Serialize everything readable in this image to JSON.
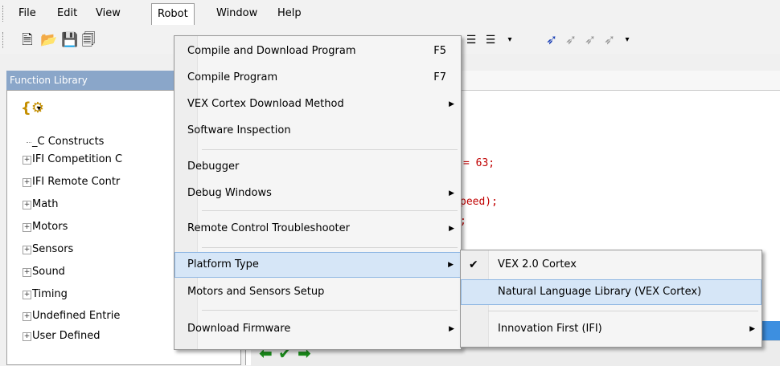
{
  "menubar": {
    "items": [
      "File",
      "Edit",
      "View",
      "Robot",
      "Window",
      "Help"
    ]
  },
  "toolbar": {
    "icons": [
      "new-file-icon",
      "open-folder-icon",
      "save-icon",
      "save-all-icon",
      "indent-icon",
      "outdent-icon",
      "bookmark-icon",
      "bookmark-next-icon",
      "bookmark-prev-icon",
      "bookmark-clear-icon"
    ]
  },
  "function_library": {
    "title": "Function Library",
    "items": [
      {
        "label": "_C Constructs",
        "expandable": false
      },
      {
        "label": "IFI Competition C",
        "expandable": true
      },
      {
        "label": "IFI Remote Contr",
        "expandable": true
      },
      {
        "label": "Math",
        "expandable": true
      },
      {
        "label": "Motors",
        "expandable": true
      },
      {
        "label": "Sensors",
        "expandable": true
      },
      {
        "label": "Sound",
        "expandable": true
      },
      {
        "label": "Timing",
        "expandable": true
      },
      {
        "label": "Undefined Entrie",
        "expandable": true
      },
      {
        "label": "User Defined",
        "expandable": true
      }
    ]
  },
  "editor": {
    "lines": [
      "= 63;",
      "peed);",
      ";"
    ]
  },
  "robot_menu": {
    "items": [
      {
        "label": "Compile and Download Program",
        "shortcut": "F5"
      },
      {
        "label": "Compile Program",
        "shortcut": "F7"
      },
      {
        "label": "VEX Cortex Download Method",
        "submenu": true
      },
      {
        "label": "Software Inspection"
      },
      {
        "label": "Debugger"
      },
      {
        "label": "Debug Windows",
        "submenu": true
      },
      {
        "label": "Remote Control Troubleshooter",
        "submenu": true
      },
      {
        "label": "Platform Type",
        "submenu": true
      },
      {
        "label": "Motors and Sensors Setup"
      },
      {
        "label": "Download Firmware",
        "submenu": true
      }
    ]
  },
  "platform_menu": {
    "items": [
      {
        "label": "VEX 2.0 Cortex",
        "checked": true
      },
      {
        "label": "Natural Language Library (VEX Cortex)"
      },
      {
        "label": "Innovation First (IFI)",
        "submenu": true
      }
    ]
  },
  "colors": {
    "highlight": "#d6e6f7",
    "panel_header": "#8aa6c9",
    "code_text": "#c00000",
    "nav_arrow": "#1a8a1a"
  }
}
